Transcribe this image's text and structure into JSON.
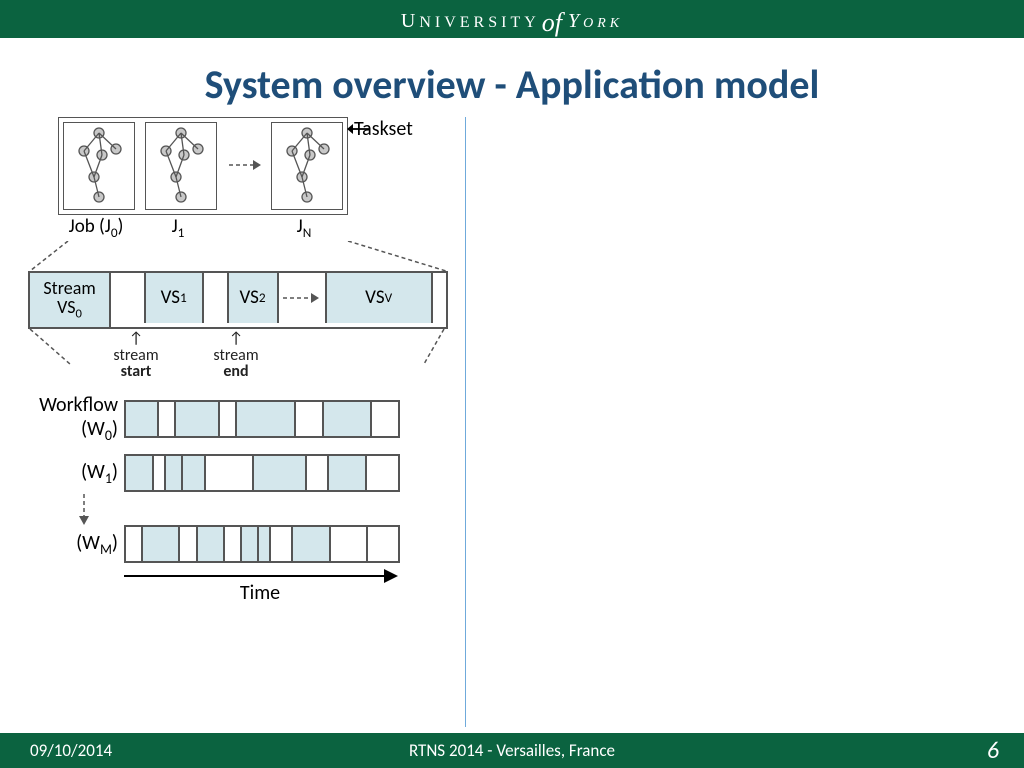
{
  "header": {
    "institution": "University of York"
  },
  "title": "System overview - Application model",
  "diagram": {
    "taskset_label": "Taskset",
    "jobs": [
      {
        "id": "J0",
        "label_html": "Job (J<sub>0</sub>)"
      },
      {
        "id": "J1",
        "label_html": "J<sub>1</sub>"
      },
      {
        "id": "JN",
        "label_html": "J<sub>N</sub>"
      }
    ],
    "stream": {
      "vs0": {
        "line1": "Stream",
        "line2_html": "VS<sub>0</sub>"
      },
      "vs": [
        "VS₁",
        "VS₂",
        "VS_V"
      ],
      "start_label": "stream start",
      "end_label": "stream end"
    },
    "workflows": {
      "label_prefix": "Workflow",
      "items": [
        {
          "id": "W0",
          "label_html": "(W<sub>0</sub>)"
        },
        {
          "id": "W1",
          "label_html": "(W<sub>1</sub>)"
        },
        {
          "id": "WM",
          "label_html": "(W<sub>M</sub>)"
        }
      ]
    },
    "axis": "Time"
  },
  "footer": {
    "date": "09/10/2014",
    "venue": "RTNS 2014 - Versailles, France",
    "page": "6"
  }
}
